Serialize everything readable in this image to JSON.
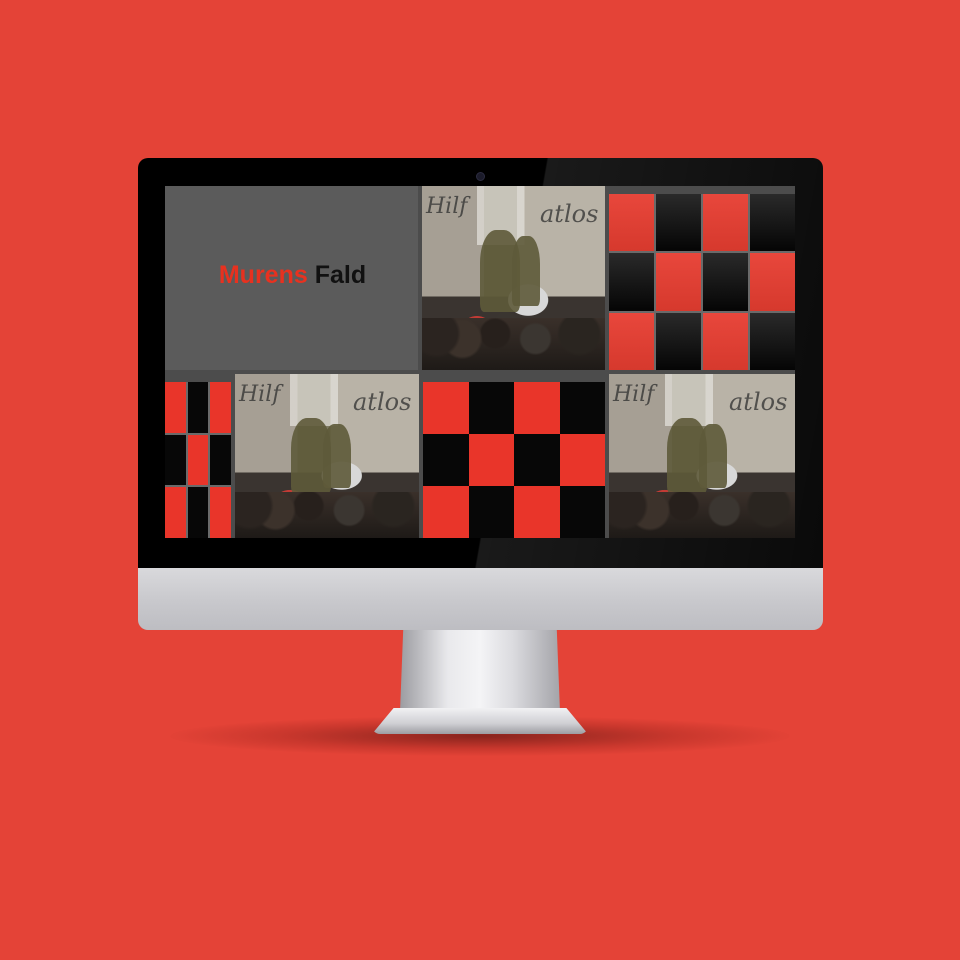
{
  "title": {
    "part1": "Murens",
    "part2": "Fald"
  },
  "photo": {
    "graffiti_left": "Hilf",
    "graffiti_right": "atlos"
  },
  "colors": {
    "background": "#e44337",
    "accent_red": "#e8311f",
    "tile_gray": "#5b5b5b"
  },
  "screen_tiles": [
    "title-tile",
    "photo",
    "checkerboard",
    "checkerboard",
    "photo",
    "checkerboard",
    "photo"
  ]
}
